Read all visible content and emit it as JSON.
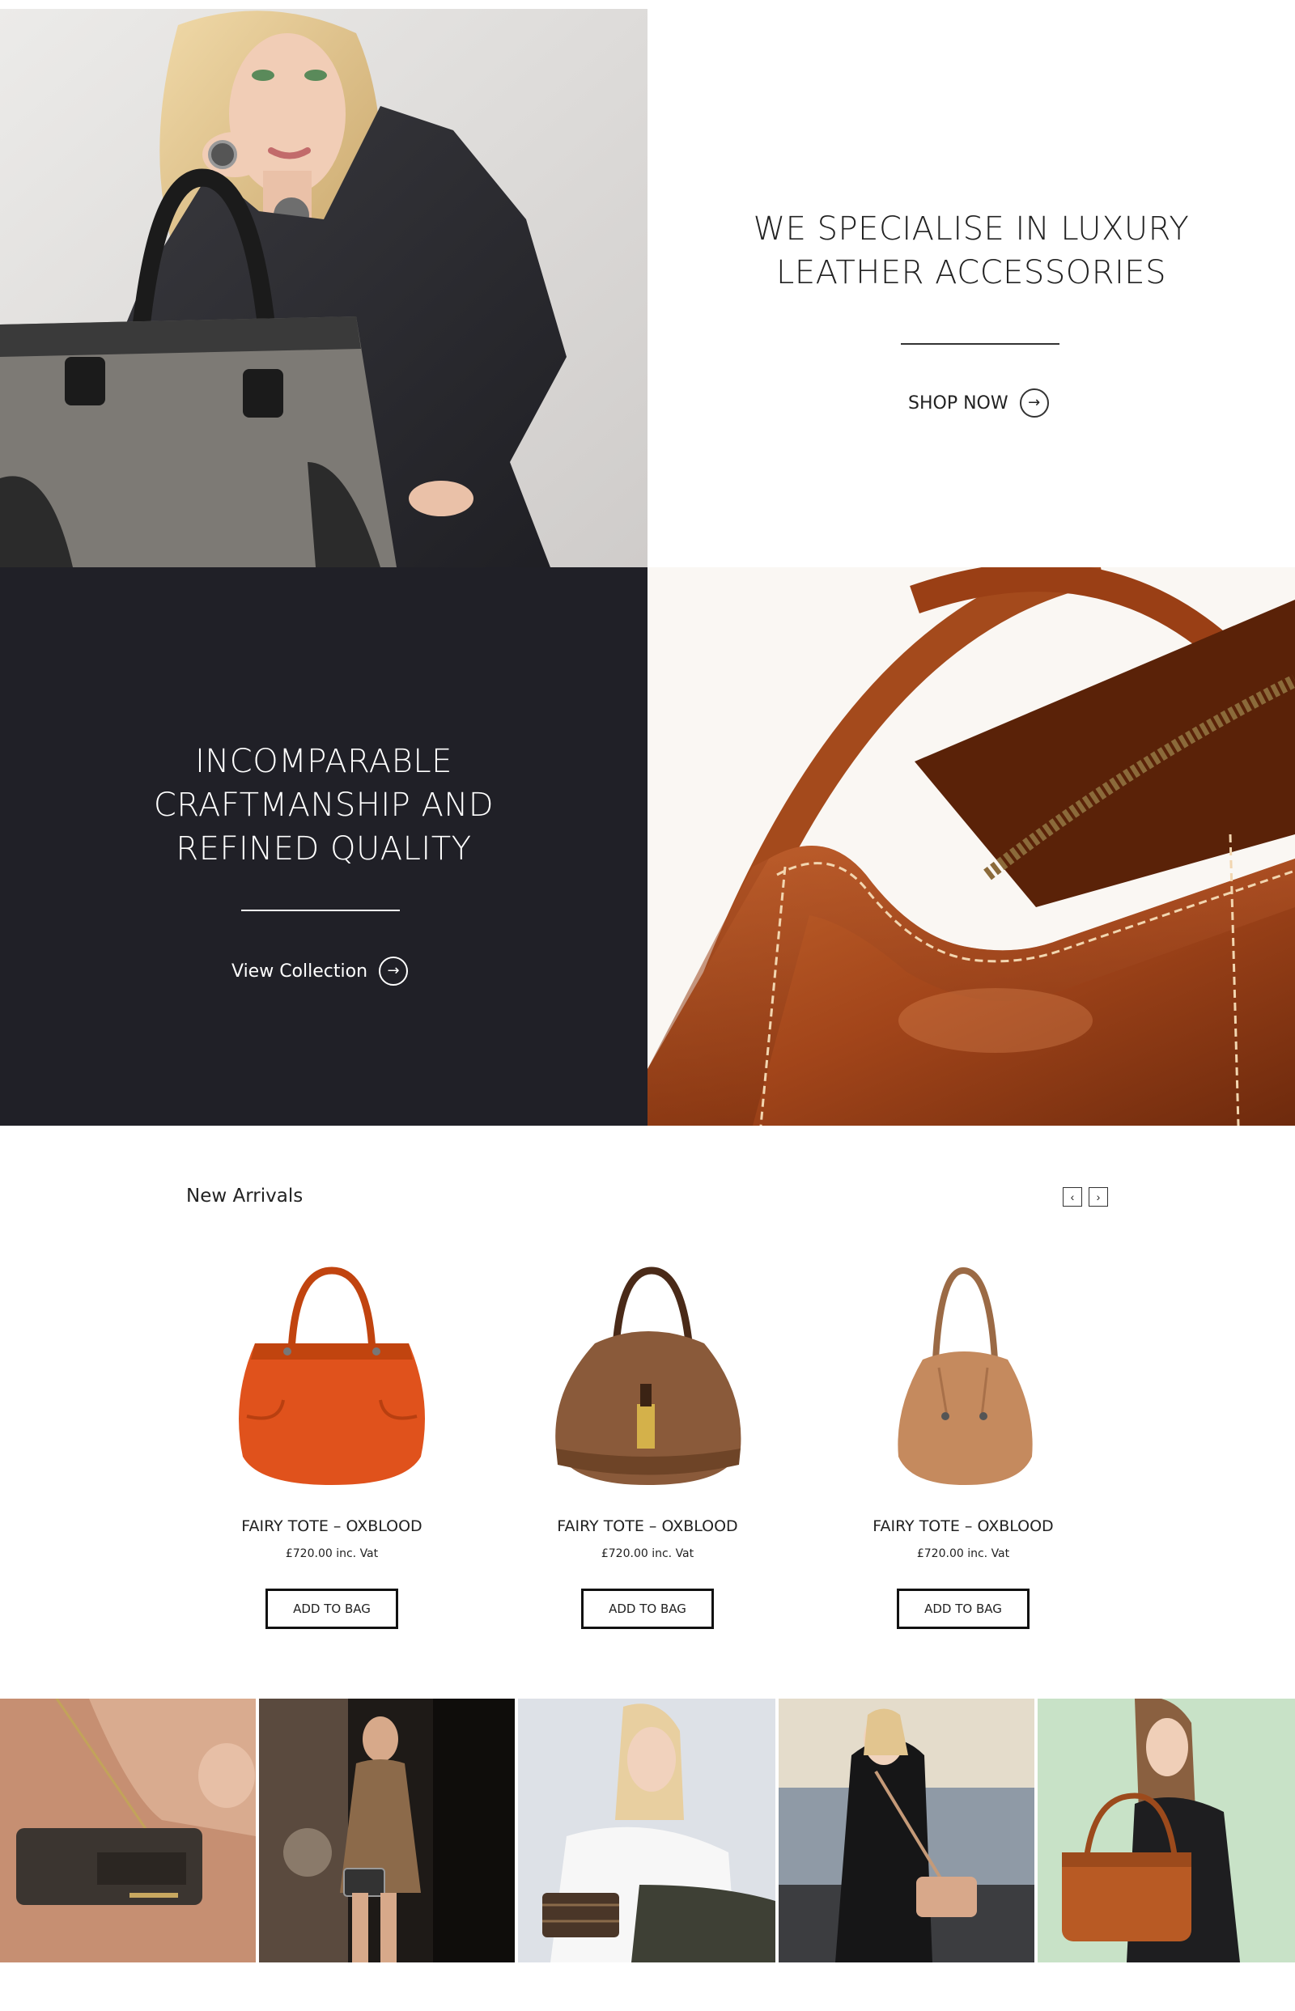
{
  "hero_primary": {
    "headline_line1": "WE SPECIALISE IN LUXURY",
    "headline_line2": "LEATHER ACCESSORIES",
    "cta_label": "SHOP NOW"
  },
  "hero_secondary": {
    "headline_line1": "INCOMPARABLE",
    "headline_line2": "CRAFTMANSHIP AND",
    "headline_line3": "REFINED QUALITY",
    "cta_label": "View Collection"
  },
  "new_arrivals": {
    "title": "New Arrivals",
    "prev_icon": "‹",
    "next_icon": "›",
    "products": [
      {
        "name": "FAIRY TOTE – OXBLOOD",
        "price": "£720.00 inc. Vat",
        "button": "ADD TO BAG",
        "color": "#e0521c"
      },
      {
        "name": "FAIRY TOTE – OXBLOOD",
        "price": "£720.00 inc. Vat",
        "button": "ADD TO BAG",
        "color": "#8a5a3a"
      },
      {
        "name": "FAIRY TOTE – OXBLOOD",
        "price": "£720.00 inc. Vat",
        "button": "ADD TO BAG",
        "color": "#c58a5e"
      }
    ]
  },
  "icons": {
    "arrow": "→"
  },
  "colors": {
    "dark_panel": "#202027",
    "text": "#222222",
    "leather": "#a8491d"
  }
}
